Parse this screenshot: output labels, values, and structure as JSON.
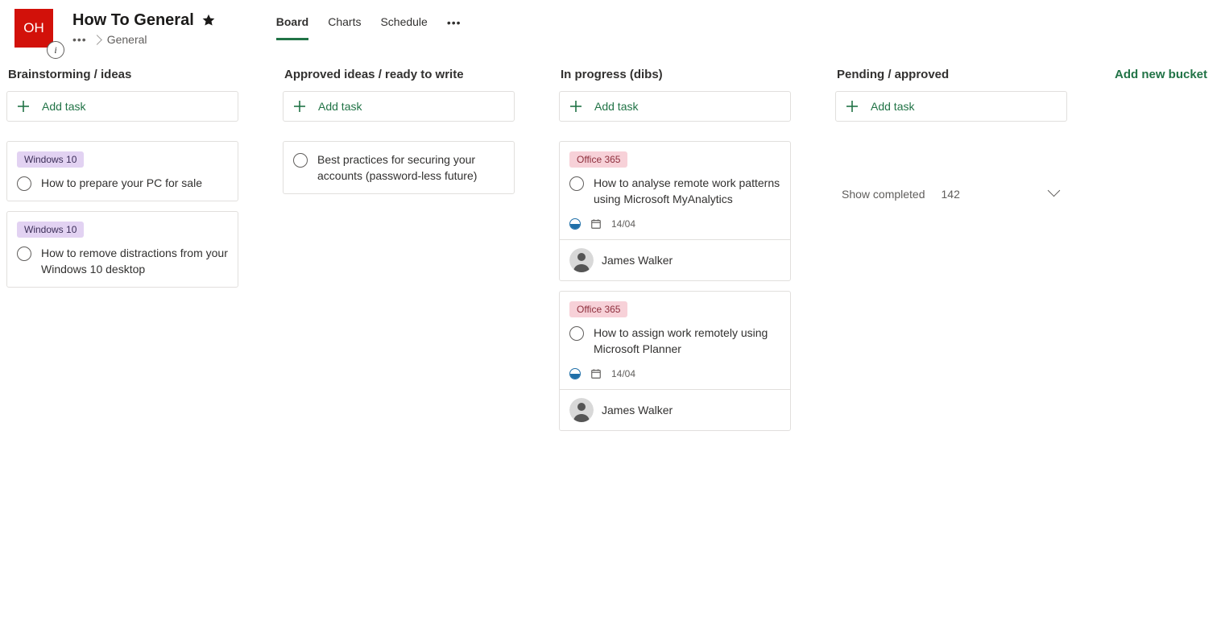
{
  "header": {
    "plan_initials": "OH",
    "plan_title": "How To General",
    "breadcrumb_item": "General",
    "tabs": {
      "board": "Board",
      "charts": "Charts",
      "schedule": "Schedule"
    }
  },
  "add_task_label": "Add task",
  "add_bucket_label": "Add new bucket",
  "buckets": [
    {
      "name": "Brainstorming / ideas",
      "cards": [
        {
          "label_text": "Windows 10",
          "label_color": "purple",
          "title": "How to prepare your PC for sale"
        },
        {
          "label_text": "Windows 10",
          "label_color": "purple",
          "title": "How to remove distractions from your Windows 10 desktop"
        }
      ]
    },
    {
      "name": "Approved ideas / ready to write",
      "cards": [
        {
          "title": "Best practices for securing your accounts (password-less future)"
        }
      ]
    },
    {
      "name": "In progress (dibs)",
      "cards": [
        {
          "label_text": "Office 365",
          "label_color": "pink",
          "title": "How to analyse remote work patterns using Microsoft MyAnalytics",
          "due": "14/04",
          "assignee": "James Walker"
        },
        {
          "label_text": "Office 365",
          "label_color": "pink",
          "title": "How to assign work remotely using Microsoft Planner",
          "due": "14/04",
          "assignee": "James Walker"
        }
      ]
    },
    {
      "name": "Pending / approved",
      "cards": []
    }
  ],
  "completed": {
    "label": "Show completed",
    "count": "142"
  }
}
